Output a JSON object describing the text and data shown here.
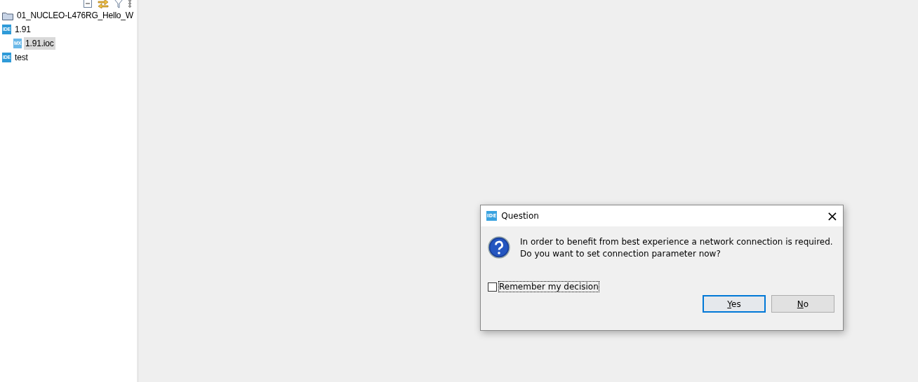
{
  "explorer": {
    "items": [
      {
        "kind": "folder",
        "label": "01_NUCLEO-L476RG_Hello_W",
        "selected": false
      },
      {
        "kind": "project",
        "badge": "IDE",
        "label": "1.91",
        "selected": false,
        "children": [
          {
            "kind": "file",
            "badge": "MX",
            "label": "1.91.ioc",
            "selected": true
          }
        ]
      },
      {
        "kind": "project",
        "badge": "IDE",
        "label": "test",
        "selected": false
      }
    ]
  },
  "dialog": {
    "badge": "IDE",
    "title": "Question",
    "close": "×",
    "message": [
      "In order to benefit from best experience a network connection is required.",
      "Do you want to set connection parameter now?"
    ],
    "checkbox": {
      "label": "Remember my decision",
      "checked": false
    },
    "buttons": [
      {
        "mnemonic": "Y",
        "rest": "es",
        "default": true
      },
      {
        "mnemonic": "N",
        "rest": "o",
        "default": false
      }
    ]
  }
}
